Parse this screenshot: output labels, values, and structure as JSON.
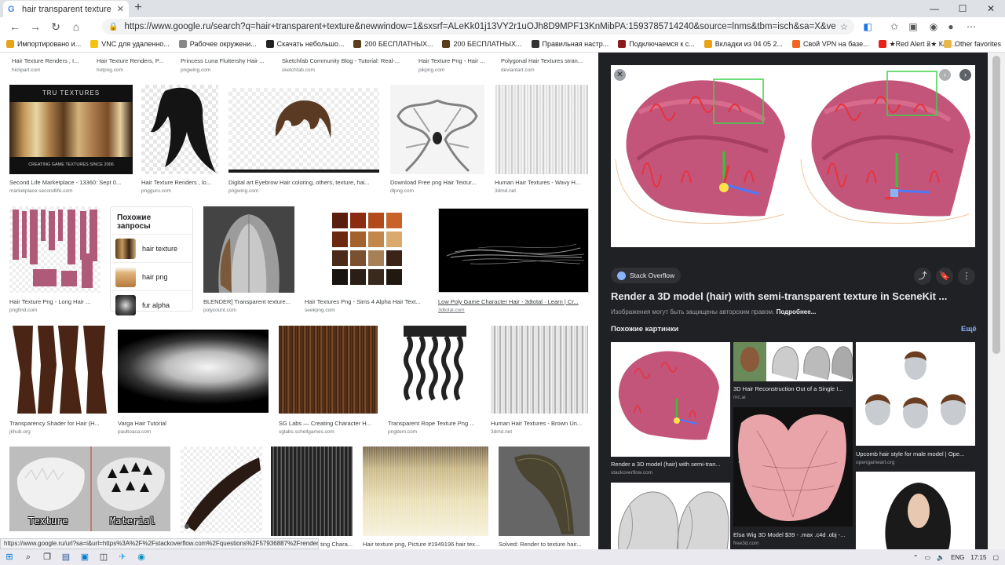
{
  "browser": {
    "tab_title": "hair transparent texture – Goog",
    "tab_close": "✕",
    "new_tab": "+",
    "url_display": "https://www.google.ru/search?q=hair+transparent+texture&newwindow=1&sxsrf=ALeKk01j13VY2r1uOJh8D9MPF13KnMibPA:1593785714240&source=lnms&tbm=isch&sa=X&ved=2ahUKE...",
    "min": "—",
    "max": "☐",
    "close": "✕"
  },
  "bookmarks": [
    {
      "label": "Импортировано и...",
      "color": "#e8a317"
    },
    {
      "label": "VNC для удаленно...",
      "color": "#f4c20d"
    },
    {
      "label": "Рабочее окружени...",
      "color": "#888888"
    },
    {
      "label": "Скачать небольшо...",
      "color": "#222222"
    },
    {
      "label": "200 БЕСПЛАТНЫХ...",
      "color": "#5a3e1b"
    },
    {
      "label": "200 БЕСПЛАТНЫХ...",
      "color": "#5a3e1b"
    },
    {
      "label": "Правильная настр...",
      "color": "#333333"
    },
    {
      "label": "Подключаемся к с...",
      "color": "#8b1a1a"
    },
    {
      "label": "Вкладки из 04 05 2...",
      "color": "#e8a317"
    },
    {
      "label": "Свой VPN на базе...",
      "color": "#f26522"
    },
    {
      "label": "★Red Alert 3★ Как...",
      "color": "#e62117"
    }
  ],
  "bookmarks_more": "›",
  "bookmarks_other": "Other favorites",
  "grid": {
    "row0": [
      {
        "cap": "Hair Texture Renders , I...",
        "src": "hiclipart.com"
      },
      {
        "cap": "Hair Texture Renders, P...",
        "src": "hotpng.com"
      },
      {
        "cap": "Princess Luna Fluttershy Hair ...",
        "src": "pngwing.com"
      },
      {
        "cap": "Sketchfab Community Blog - Tutorial: Real-...",
        "src": "sketchfab.com"
      },
      {
        "cap": "Hair Texture Png - Hair ...",
        "src": "pikpng.com"
      },
      {
        "cap": "Polygonal Hair Textures stran...",
        "src": "deviantart.com"
      }
    ],
    "row1": [
      {
        "cap": "Second Life Marketplace - 13360: Sept 0...",
        "src": "marketplace.secondlife.com",
        "overlay": "TRU TEXTURES",
        "overlay2": "CREATING GAME TEXTURES SINCE 2006"
      },
      {
        "cap": "Hair Texture Renders , lo...",
        "src": "pngguru.com"
      },
      {
        "cap": "Digital art Eyebrow Hair coloring, others, texture, hai...",
        "src": "pngwing.com"
      },
      {
        "cap": "Download Free png Hair Textur...",
        "src": "dlpng.com"
      },
      {
        "cap": "Human Hair Textures - Wavy H...",
        "src": "3dmd.net"
      }
    ],
    "row2": [
      {
        "cap": "Hair Texture Png - Long Hair ...",
        "src": "pngfind.com"
      },
      {
        "cap": "BLENDER] Transparent texture...",
        "src": "polycount.com"
      },
      {
        "cap": "Hair Textures Png - Sims 4 Alpha Hair Text...",
        "src": "seekpng.com"
      },
      {
        "cap": "Low Poly Game Character Hair - 3dtotal · Learn | Cr...",
        "src": "3dtotal.com"
      }
    ],
    "row3": [
      {
        "cap": "Transparency Shader for Hair (H...",
        "src": "jkhub.org"
      },
      {
        "cap": "Varga Hair Tutorial",
        "src": "paultoaca.com"
      },
      {
        "cap": "SG Labs — Creating Character H...",
        "src": "sglabs.schellgames.com"
      },
      {
        "cap": "Transparent Rope Texture Png ...",
        "src": "pngitem.com"
      },
      {
        "cap": "Human Hair Textures - Brown Un...",
        "src": "3dmd.net"
      }
    ],
    "row4": [
      {
        "cap": "",
        "src": "",
        "overlay": "Texture",
        "overlay2": "Material"
      },
      {
        "cap": "",
        "src": ""
      },
      {
        "cap": "ting Chara...",
        "src": ""
      },
      {
        "cap": "Hair texture png, Picture #1949196 hair tex...",
        "src": ""
      },
      {
        "cap": "Solved: Render to texture hair...",
        "src": ""
      }
    ]
  },
  "related": {
    "title": "Похожие запросы",
    "items": [
      "hair texture",
      "hair png",
      "fur alpha"
    ]
  },
  "panel": {
    "close": "✕",
    "prev": "‹",
    "next": "›",
    "site": "Stack Overflow",
    "share": "⤴",
    "save": "🔖",
    "more": "⋮",
    "title": "Render a 3D model (hair) with semi-transparent texture in SceneKit ...",
    "note": "Изображения могут быть защищены авторским правом.",
    "note_link": "Подробнее...",
    "similar_head": "Похожие картинки",
    "similar_more": "Ещё",
    "similar": [
      {
        "cap": "Render a 3D model (hair) with semi-tran...",
        "src": "stackoverflow.com"
      },
      {
        "cap": "3D Hair Reconstruction Out of a Single I...",
        "src": "mc.ai"
      },
      {
        "cap": "Upcomb hair style for male model | Ope...",
        "src": "opengameart.org"
      },
      {
        "cap": "Elsa Wig 3D Model $39 - .max .c4d .obj -...",
        "src": "free3d.com"
      }
    ]
  },
  "status_url": "https://www.google.ru/url?sa=i&url=https%3A%2F%2Fstackoverflow.com%2Fquestions%2F57936887%2Frender-...",
  "taskbar": {
    "lang": "ENG",
    "time": "17:15"
  }
}
